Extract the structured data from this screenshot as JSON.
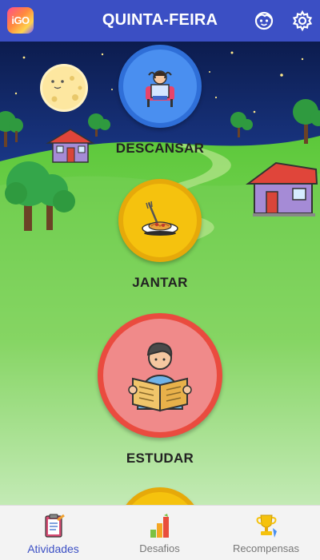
{
  "header": {
    "logo_text": "iGO",
    "title": "QUINTA-FEIRA",
    "icons": [
      "kid-face-icon",
      "settings-gear-icon"
    ],
    "color": "#3b4fc4"
  },
  "activities": [
    {
      "label": "DESCANSAR",
      "icon": "resting-person-icon",
      "color": "#4a8ff0"
    },
    {
      "label": "JANTAR",
      "icon": "spaghetti-plate-icon",
      "color": "#f5c20e"
    },
    {
      "label": "ESTUDAR",
      "icon": "reading-student-icon",
      "color": "#f0574a"
    }
  ],
  "nav": {
    "items": [
      {
        "label": "Atividades",
        "icon": "clipboard-icon",
        "active": true
      },
      {
        "label": "Desafios",
        "icon": "bar-chart-icon",
        "active": false
      },
      {
        "label": "Recompensas",
        "icon": "trophy-icon",
        "active": false
      }
    ]
  }
}
